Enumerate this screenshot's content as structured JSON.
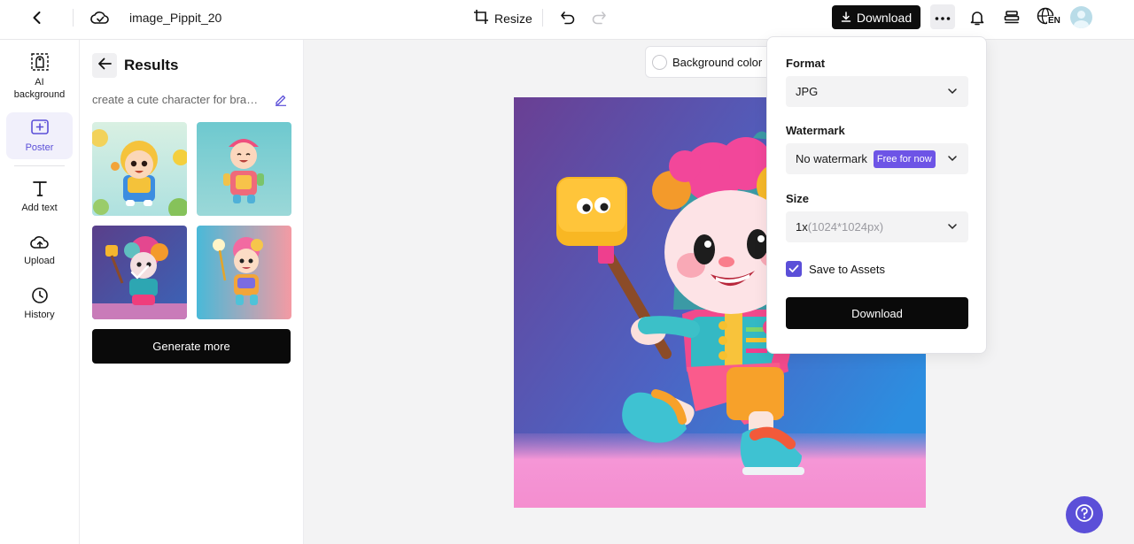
{
  "topbar": {
    "file_name": "image_Pippit_20",
    "resize_label": "Resize",
    "download_label": "Download",
    "language_code": "EN"
  },
  "leftnav": {
    "items": [
      {
        "label": "AI background",
        "icon": "ai-background-icon"
      },
      {
        "label": "Poster",
        "icon": "poster-icon",
        "active": true
      },
      {
        "label": "Add text",
        "icon": "text-icon"
      },
      {
        "label": "Upload",
        "icon": "upload-cloud-icon"
      },
      {
        "label": "History",
        "icon": "clock-icon"
      }
    ]
  },
  "panel": {
    "title": "Results",
    "prompt": "create a cute character for bran...",
    "generate_more": "Generate more"
  },
  "canvas": {
    "background_color_label": "Background color"
  },
  "export_popup": {
    "format_label": "Format",
    "format_value": "JPG",
    "watermark_label": "Watermark",
    "watermark_value": "No watermark",
    "watermark_badge": "Free for now",
    "size_label": "Size",
    "size_value": "1x",
    "size_detail": "(1024*1024px)",
    "save_to_assets_label": "Save to Assets",
    "save_to_assets_checked": true,
    "download_label": "Download"
  },
  "colors": {
    "accent": "#5b4fd8",
    "badge": "#6d54e6",
    "primary_button": "#0a0a0a"
  }
}
